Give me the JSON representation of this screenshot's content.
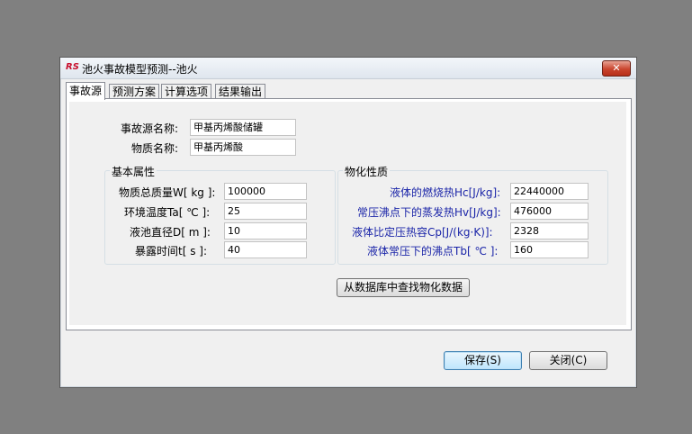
{
  "window": {
    "title": "池火事故模型预测--池火",
    "close_label": "✕"
  },
  "tabs": [
    {
      "label": "事故源"
    },
    {
      "label": "预测方案"
    },
    {
      "label": "计算选项"
    },
    {
      "label": "结果输出"
    }
  ],
  "source": {
    "name_label": "事故源名称:",
    "name_value": "甲基丙烯酸储罐",
    "substance_label": "物质名称:",
    "substance_value": "甲基丙烯酸"
  },
  "basic": {
    "title": "基本属性",
    "mass_label": "物质总质量W[ kg ]:",
    "mass_value": "100000",
    "temp_label": "环境温度Ta[ ℃ ]:",
    "temp_value": "25",
    "diameter_label": "液池直径D[  m ]:",
    "diameter_value": "10",
    "time_label": "暴露时间t[ s ]:",
    "time_value": "40"
  },
  "physchem": {
    "title": "物化性质",
    "hc_label": "液体的燃烧热Hc[J/kg]:",
    "hc_value": "22440000",
    "hv_label": "常压沸点下的蒸发热Hv[J/kg]:",
    "hv_value": "476000",
    "cp_label": "液体比定压热容Cp[J/(kg·K)]:",
    "cp_value": "2328",
    "tb_label": "液体常压下的沸点Tb[ ℃ ]:",
    "tb_value": "160"
  },
  "lookup_button": "从数据库中查找物化数据",
  "footer": {
    "save_label": "保存(S)",
    "close_label": "关闭(C)"
  }
}
